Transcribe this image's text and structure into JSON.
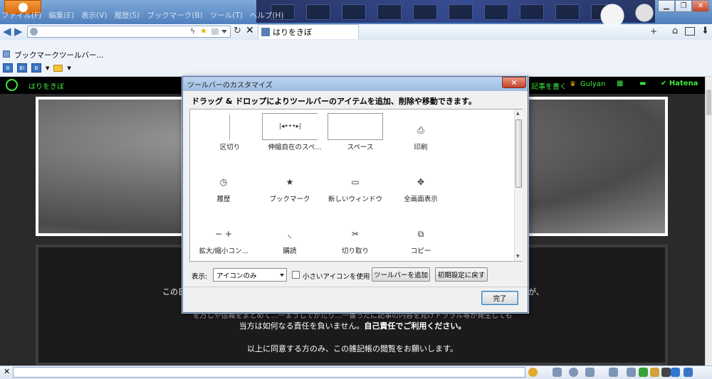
{
  "app": {
    "menu": [
      "ファイル(F)",
      "編集(E)",
      "表示(V)",
      "履歴(S)",
      "ブックマーク(B)",
      "ツール(T)",
      "ヘルプ(H)"
    ],
    "tab_title": "はりをきぼ"
  },
  "bookmarks": {
    "folder_label": "ブックマークツールバー..."
  },
  "hatena_bar": {
    "user_label": "はりをきぼ",
    "write_label": "記事を書く",
    "user2_label": "Gulyan",
    "brand": "Hatena"
  },
  "page": {
    "line1_left": "この日",
    "line1_right": "が、",
    "line2": "を万しや信報をまとめて…一まうしでかたり…一番ったに記事の内容を見けトララル等が発生しても",
    "line3a": "当方は如何なる責任を負いません。",
    "line3b": "自己責任でご利用ください。",
    "line4": "以上に同意する方のみ、この雑記帳の閲覧をお願いします。"
  },
  "dialog": {
    "title": "ツールバーのカスタマイズ",
    "instruction": "ドラッグ & ドロップによりツールバーのアイテムを追加、削除や移動できます。",
    "items": [
      {
        "label": "区切り",
        "icon": "separator-icon"
      },
      {
        "label": "伸縮自在のスペ...",
        "icon": "flexible-space-icon"
      },
      {
        "label": "スペース",
        "icon": "space-icon"
      },
      {
        "label": "印刷",
        "icon": "printer-icon"
      },
      {
        "label": "履歴",
        "icon": "history-clock-icon"
      },
      {
        "label": "ブックマーク",
        "icon": "bookmark-star-icon"
      },
      {
        "label": "新しいウィンドウ",
        "icon": "new-window-icon"
      },
      {
        "label": "全画面表示",
        "icon": "fullscreen-arrows-icon"
      },
      {
        "label": "拡大/縮小コン...",
        "icon": "zoom-minus-plus-icon"
      },
      {
        "label": "購読",
        "icon": "rss-feed-icon"
      },
      {
        "label": "切り取り",
        "icon": "scissors-icon"
      },
      {
        "label": "コピー",
        "icon": "copy-icon"
      }
    ],
    "glyphs": [
      "│",
      "|◂•••▸|",
      "",
      "⎙",
      "◷",
      "★",
      "▭",
      "✥",
      "−  +",
      "◟",
      "✂",
      "⧉"
    ],
    "show_label": "表示:",
    "show_value": "アイコンのみ",
    "small_icons_label": "小さいアイコンを使用",
    "add_toolbar_label": "ツールバーを追加",
    "reset_label": "初期設定に戻す",
    "done_label": "完了"
  },
  "colors": {
    "hatena_green": "#3ee83e",
    "firefox_orange": "#e8791e"
  }
}
